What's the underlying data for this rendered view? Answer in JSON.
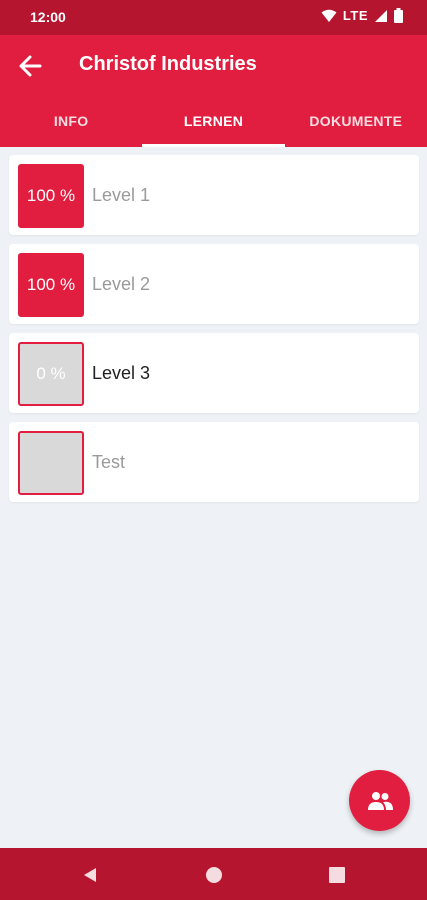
{
  "status_bar": {
    "time": "12:00",
    "network": "LTE"
  },
  "app_bar": {
    "title": "Christof Industries"
  },
  "tabs": [
    {
      "label": "INFO",
      "active": false
    },
    {
      "label": "LERNEN",
      "active": true
    },
    {
      "label": "DOKUMENTE",
      "active": false
    }
  ],
  "levels": [
    {
      "badge": "100 %",
      "label": "Level 1",
      "progress": 1.0,
      "locked": true
    },
    {
      "badge": "100 %",
      "label": "Level 2",
      "progress": 1.0,
      "locked": true
    },
    {
      "badge": "0 %",
      "label": "Level 3",
      "progress": 0.0,
      "locked": false
    },
    {
      "badge": "",
      "label": "Test",
      "progress": 0.0,
      "locked": true
    }
  ],
  "colors": {
    "primary": "#e11e3f",
    "primary_dark": "#b5152e",
    "background": "#eef2f6"
  },
  "icons": {
    "back": "arrow-left-icon",
    "fab": "group-icon"
  }
}
